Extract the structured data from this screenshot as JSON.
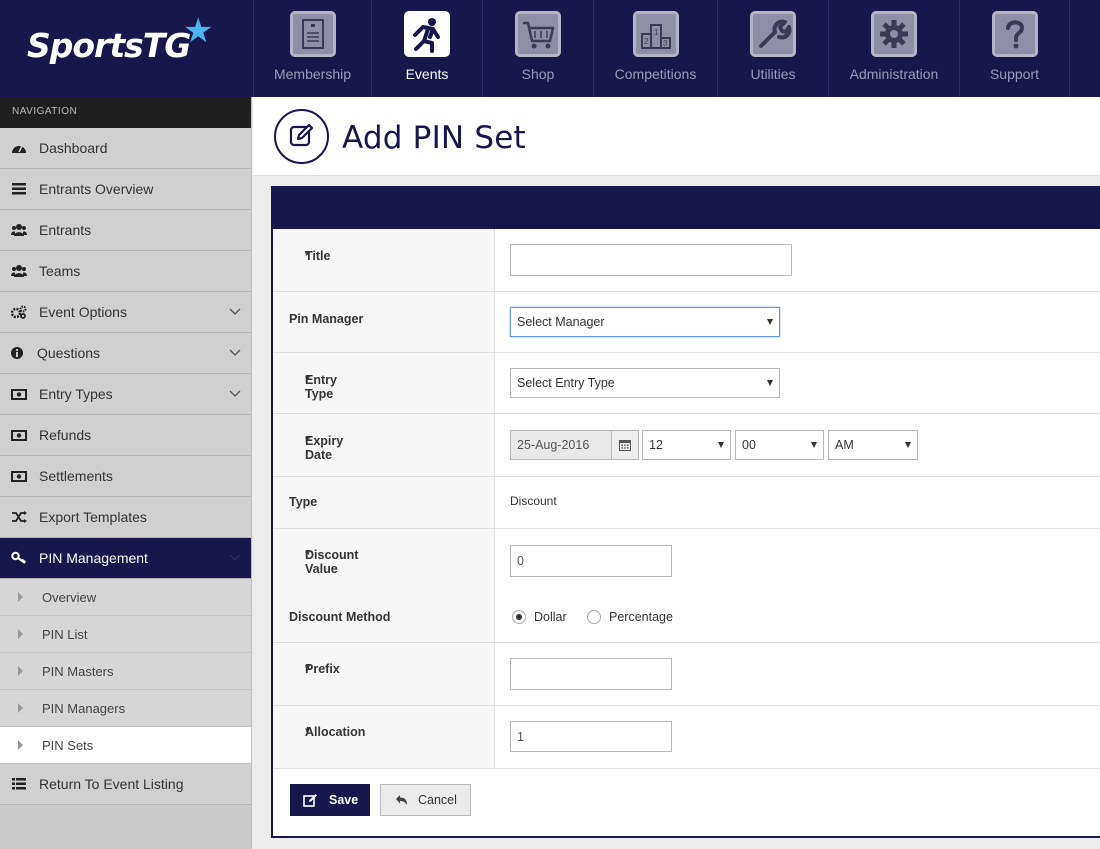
{
  "brand": {
    "logo_text": "SportsTG"
  },
  "topnav": [
    {
      "label": "Membership",
      "icon": "membership-card-icon"
    },
    {
      "label": "Events",
      "icon": "runner-icon",
      "active": true
    },
    {
      "label": "Shop",
      "icon": "shopping-cart-icon"
    },
    {
      "label": "Competitions",
      "icon": "podium-icon"
    },
    {
      "label": "Utilities",
      "icon": "wrench-icon"
    },
    {
      "label": "Administration",
      "icon": "gear-icon"
    },
    {
      "label": "Support",
      "icon": "question-icon"
    }
  ],
  "sidebar": {
    "heading": "NAVIGATION",
    "items": [
      {
        "label": "Dashboard",
        "icon": "dashboard-icon"
      },
      {
        "label": "Entrants Overview",
        "icon": "list-icon"
      },
      {
        "label": "Entrants",
        "icon": "users-icon"
      },
      {
        "label": "Teams",
        "icon": "users-icon"
      },
      {
        "label": "Event Options",
        "icon": "cogs-icon"
      },
      {
        "label": "Questions",
        "icon": "info-icon"
      },
      {
        "label": "Entry Types",
        "icon": "money-icon"
      },
      {
        "label": "Refunds",
        "icon": "money-icon"
      },
      {
        "label": "Settlements",
        "icon": "money-icon"
      },
      {
        "label": "Export Templates",
        "icon": "shuffle-icon"
      },
      {
        "label": "PIN Management",
        "icon": "key-icon"
      }
    ],
    "sub_items": [
      {
        "label": "Overview"
      },
      {
        "label": "PIN List"
      },
      {
        "label": "PIN Masters"
      },
      {
        "label": "PIN Managers"
      },
      {
        "label": "PIN Sets"
      }
    ],
    "footer_item": {
      "label": "Return To Event Listing",
      "icon": "list-icon"
    }
  },
  "page": {
    "title": "Add PIN Set"
  },
  "form": {
    "title": {
      "label": "Title",
      "required_mark": "*",
      "value": ""
    },
    "pin_manager": {
      "label": "Pin Manager",
      "selected": "Select Manager"
    },
    "entry_type": {
      "label": "Entry Type",
      "required_mark": "*",
      "selected": "Select Entry Type"
    },
    "expiry_date": {
      "label": "Expiry Date",
      "required_mark": "*",
      "date": "25-Aug-2016",
      "hour": "12",
      "minute": "00",
      "ampm": "AM"
    },
    "type": {
      "label": "Type",
      "value": "Discount"
    },
    "discount_value": {
      "label": "Discount Value",
      "required_mark": "*",
      "value": "0"
    },
    "discount_method": {
      "label": "Discount Method",
      "options": [
        "Dollar",
        "Percentage"
      ],
      "selected": "Dollar"
    },
    "prefix": {
      "label": "Prefix",
      "required_mark": "*",
      "value": ""
    },
    "allocation": {
      "label": "Allocation",
      "required_mark": "*",
      "value": "1"
    },
    "save_label": "Save",
    "cancel_label": "Cancel"
  },
  "colors": {
    "brand_navy": "#17174e",
    "accent_blue": "#4fb3ee",
    "sidebar_bg": "#cacaca"
  }
}
